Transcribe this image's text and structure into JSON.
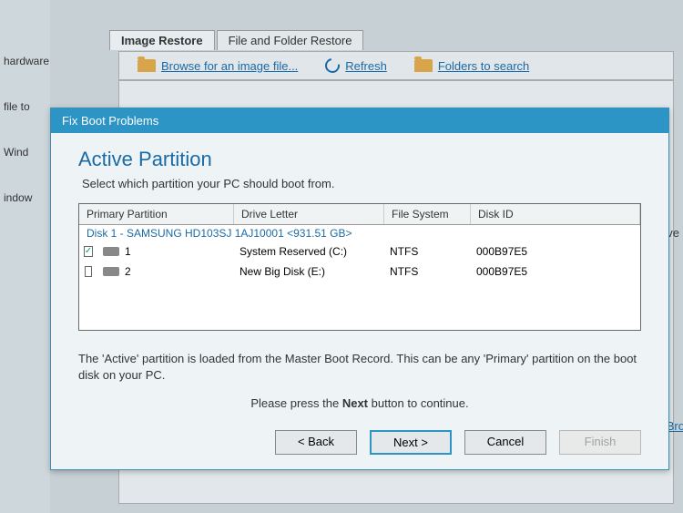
{
  "bg_sidebar": {
    "i0": "hardware",
    "i1": "file to",
    "i2": "Wind",
    "i3": "indow"
  },
  "tabs": {
    "t0": "Image Restore",
    "t1": "File and Folder Restore"
  },
  "toolbar": {
    "browse": "Browse for an image file...",
    "refresh": "Refresh",
    "folders": "Folders to search"
  },
  "right_text": "ain drive",
  "right_link": "Bro",
  "modal": {
    "title": "Fix Boot Problems",
    "heading": "Active Partition",
    "sub": "Select which partition your PC should boot from.",
    "headers": {
      "pp": "Primary Partition",
      "dl": "Drive Letter",
      "fs": "File System",
      "did": "Disk ID"
    },
    "disk_label": "Disk 1 - SAMSUNG HD103SJ 1AJ10001  <931.51 GB>",
    "rows": [
      {
        "checked": true,
        "n": "1",
        "dl": "System Reserved (C:)",
        "fs": "NTFS",
        "did": "000B97E5"
      },
      {
        "checked": false,
        "n": "2",
        "dl": "New Big Disk (E:)",
        "fs": "NTFS",
        "did": "000B97E5"
      }
    ],
    "hint": "The 'Active' partition is loaded from the Master Boot Record. This can be any 'Primary' partition on the boot disk on your PC.",
    "press_pre": "Please press the ",
    "press_bold": "Next",
    "press_post": " button to continue.",
    "buttons": {
      "back": "< Back",
      "next": "Next >",
      "cancel": "Cancel",
      "finish": "Finish"
    }
  }
}
